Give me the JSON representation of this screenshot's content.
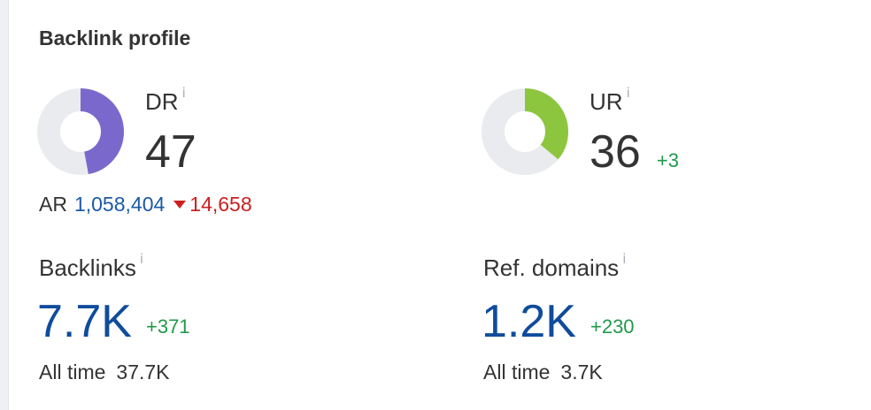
{
  "card": {
    "title": "Backlink profile"
  },
  "dr": {
    "label": "DR",
    "info": "i",
    "value": "47",
    "fill_fraction": 0.47,
    "color": "#7b68cc"
  },
  "ur": {
    "label": "UR",
    "info": "i",
    "value": "36",
    "delta": "+3",
    "fill_fraction": 0.36,
    "color": "#8cc63f"
  },
  "ar": {
    "label": "AR",
    "value": "1,058,404",
    "delta": "14,658"
  },
  "backlinks": {
    "label": "Backlinks",
    "info": "i",
    "value": "7.7K",
    "delta": "+371",
    "all_time_label": "All time",
    "all_time_value": "37.7K"
  },
  "ref_domains": {
    "label": "Ref. domains",
    "info": "i",
    "value": "1.2K",
    "delta": "+230",
    "all_time_label": "All time",
    "all_time_value": "3.7K"
  },
  "colors": {
    "track": "#e9ebee",
    "link_blue": "#1b5aa6",
    "big_blue": "#0f4c9c",
    "green": "#1f9a4a",
    "red": "#cc1f1f"
  }
}
